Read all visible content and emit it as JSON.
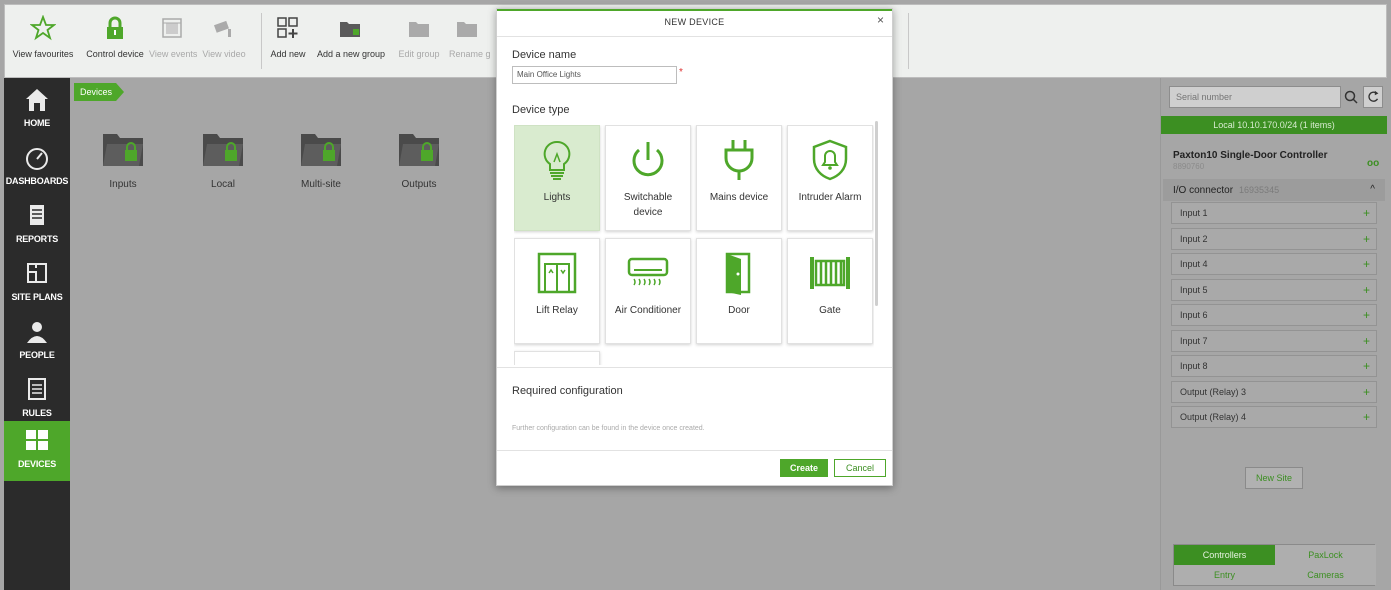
{
  "toolbar": {
    "buttons": [
      {
        "label": "View favourites",
        "icon": "star-icon",
        "enabled": true
      },
      {
        "label": "Control device",
        "icon": "lock-icon",
        "enabled": true
      },
      {
        "label": "View events",
        "icon": "calendar-icon",
        "enabled": false
      },
      {
        "label": "View video",
        "icon": "camera-icon",
        "enabled": false
      },
      {
        "label": "Add new",
        "icon": "add-grid-icon",
        "enabled": true
      },
      {
        "label": "Add a new group",
        "icon": "folder-add-icon",
        "enabled": true
      },
      {
        "label": "Edit group",
        "icon": "folder-edit-icon",
        "enabled": false
      },
      {
        "label": "Rename group",
        "icon": "folder-rename-icon",
        "enabled": false
      }
    ]
  },
  "nav": {
    "items": [
      {
        "label": "HOME",
        "icon": "home-icon",
        "active": false
      },
      {
        "label": "DASHBOARDS",
        "icon": "dashboard-icon",
        "active": false
      },
      {
        "label": "REPORTS",
        "icon": "reports-icon",
        "active": false
      },
      {
        "label": "SITE PLANS",
        "icon": "site-plans-icon",
        "active": false
      },
      {
        "label": "PEOPLE",
        "icon": "person-icon",
        "active": false
      },
      {
        "label": "RULES",
        "icon": "rules-icon",
        "active": false
      },
      {
        "label": "DEVICES",
        "icon": "devices-grid-icon",
        "active": true
      }
    ]
  },
  "main": {
    "breadcrumb": "Devices",
    "folders": [
      "Inputs",
      "Local",
      "Multi-site",
      "Outputs"
    ]
  },
  "right_panel": {
    "search_placeholder": "Serial number",
    "site_bar": "Local 10.10.170.0/24 (1 items)",
    "controller": {
      "name": "Paxton10 Single-Door Controller",
      "serial": "8890760",
      "link_icon": "oo"
    },
    "io_connector": {
      "label": "I/O connector",
      "serial": "16935345",
      "chevron": "^"
    },
    "items": [
      "Input 1",
      "Input 2",
      "Input 4",
      "Input 5",
      "Input 6",
      "Input 7",
      "Input 8",
      "Output (Relay) 3",
      "Output (Relay) 4"
    ],
    "plus_glyph": "+",
    "new_site": "New Site",
    "tabs": [
      {
        "label": "Controllers",
        "active": true
      },
      {
        "label": "PaxLock",
        "active": false
      },
      {
        "label": "Entry",
        "active": false
      },
      {
        "label": "Cameras",
        "active": false
      }
    ]
  },
  "modal": {
    "title": "NEW DEVICE",
    "close": "×",
    "device_name_label": "Device name",
    "device_name_value": "Main Office Lights",
    "required_mark": "*",
    "device_type_label": "Device type",
    "types": [
      {
        "label": "Lights",
        "icon": "lightbulb-icon",
        "selected": true
      },
      {
        "label": "Switchable device",
        "icon": "power-icon",
        "selected": false
      },
      {
        "label": "Mains device",
        "icon": "plug-icon",
        "selected": false
      },
      {
        "label": "Intruder Alarm",
        "icon": "alarm-bell-icon",
        "selected": false
      },
      {
        "label": "Lift Relay",
        "icon": "lift-icon",
        "selected": false
      },
      {
        "label": "Air Conditioner",
        "icon": "air-conditioner-icon",
        "selected": false
      },
      {
        "label": "Door",
        "icon": "door-icon",
        "selected": false
      },
      {
        "label": "Gate",
        "icon": "gate-icon",
        "selected": false
      },
      {
        "label": "",
        "icon": "",
        "selected": false
      }
    ],
    "required_config_label": "Required configuration",
    "note": "Further configuration can be found in the device once created.",
    "create_label": "Create",
    "cancel_label": "Cancel"
  },
  "colors": {
    "accent": "#4ea72a",
    "accent_dark": "#3c8f22",
    "nav_bg": "#2b2b2b",
    "overlay": "#a6a6a6"
  }
}
